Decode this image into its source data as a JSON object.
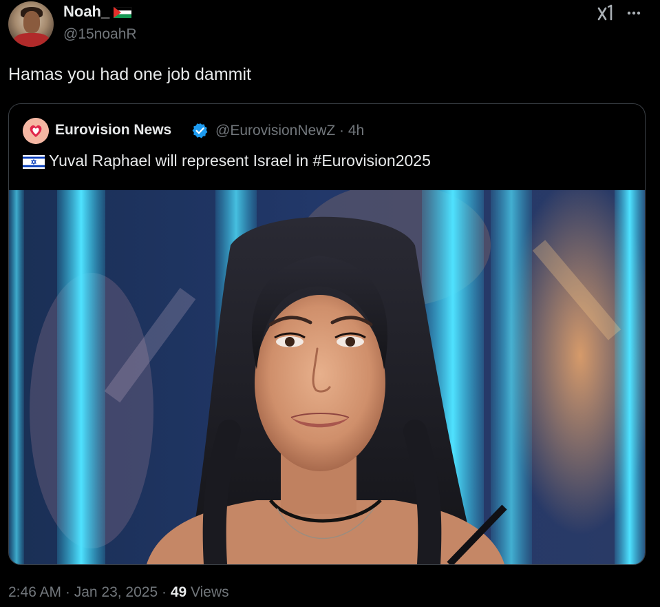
{
  "author": {
    "name": "Noah_",
    "handle": "@15noahR"
  },
  "tweet": {
    "text": "Hamas you had one job dammit"
  },
  "quoted_tweet": {
    "name": "Eurovision News",
    "handle_time": "@EurovisionNewZ · 4h",
    "text": "Yuval Raphael will represent Israel in #Eurovision2025"
  },
  "footer": {
    "timestamp": "2:46 AM · Jan 23, 2025 · ",
    "views_count": "49",
    "views_label": " Views"
  },
  "icons": {
    "avatar": "user-avatar",
    "name_flag": "palestine-flag-icon",
    "grok": "grok-icon",
    "more": "more-options-icon",
    "verified": "verified-badge-icon",
    "text_flag": "israel-flag-icon"
  },
  "colors": {
    "background": "#000000",
    "text_primary": "#e7e9ea",
    "text_secondary": "#71767b",
    "border": "#3b4046",
    "verified": "#1d9bf0"
  }
}
